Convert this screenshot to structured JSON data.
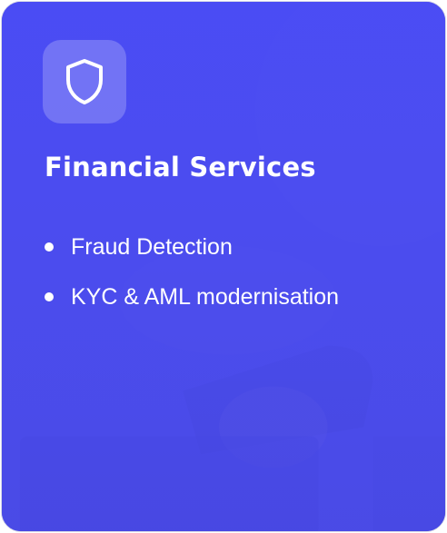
{
  "card": {
    "icon": "shield-icon",
    "title": "Financial Services",
    "features": [
      {
        "label": "Fraud Detection"
      },
      {
        "label": "KYC & AML modernisation"
      }
    ]
  },
  "colors": {
    "card_background": "#4a4cf0",
    "icon_tile": "#7a7cf5",
    "text": "#ffffff"
  }
}
